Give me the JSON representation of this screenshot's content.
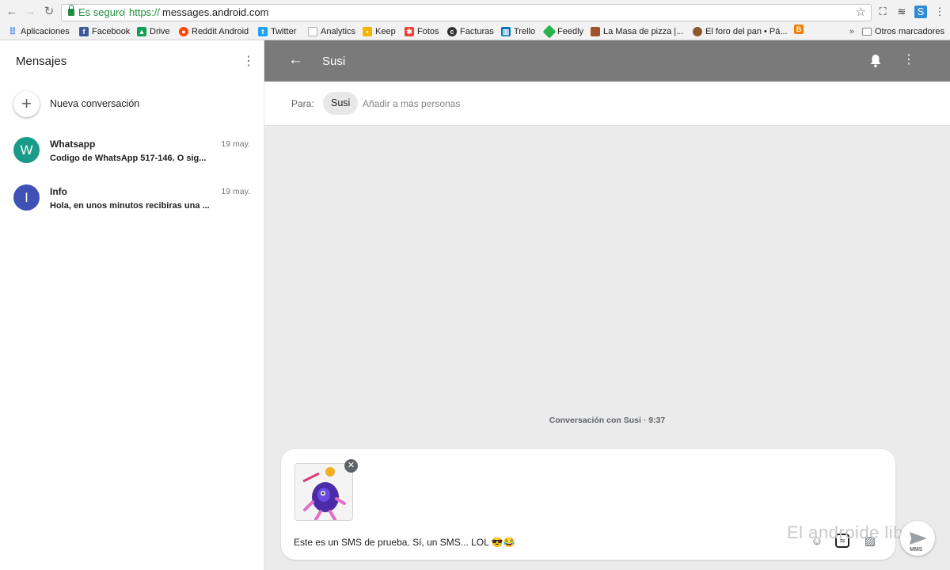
{
  "browser": {
    "secure_label": "Es seguro",
    "url_scheme": "https://",
    "url_rest": "messages.android.com",
    "bookmarks": [
      {
        "label": "Aplicaciones",
        "color": "#4285f4"
      },
      {
        "label": "Facebook",
        "color": "#3b5998"
      },
      {
        "label": "Drive",
        "color": "#0f9d58"
      },
      {
        "label": "Reddit Android",
        "color": "#ff4500"
      },
      {
        "label": "Twitter",
        "color": "#1da1f2"
      },
      {
        "label": "Analytics",
        "color": "#9e9e9e"
      },
      {
        "label": "Keep",
        "color": "#f4b400"
      },
      {
        "label": "Fotos",
        "color": "#ea4335"
      },
      {
        "label": "Facturas",
        "color": "#333333"
      },
      {
        "label": "Trello",
        "color": "#0079bf"
      },
      {
        "label": "Feedly",
        "color": "#2bb24c"
      },
      {
        "label": "La Masa de pizza |...",
        "color": "#a0522d"
      },
      {
        "label": "El foro del pan • Pá...",
        "color": "#8b5a2b"
      },
      {
        "label": "",
        "color": "#f57d00"
      }
    ],
    "more_bookmarks": "»",
    "other_bookmarks": "Otros marcadores"
  },
  "sidebar": {
    "title": "Mensajes",
    "new_conversation": "Nueva conversación",
    "conversations": [
      {
        "initial": "W",
        "name": "Whatsapp",
        "snippet": "Codigo de WhatsApp 517-146. O sig...",
        "date": "19 may.",
        "color": "#1a9b8a"
      },
      {
        "initial": "I",
        "name": "Info",
        "snippet": "Hola, en unos minutos recibiras una ...",
        "date": "19 may.",
        "color": "#3f51b5"
      }
    ]
  },
  "main": {
    "title": "Susi",
    "to_label": "Para:",
    "recipient": "Susi",
    "add_people_placeholder": "Añadir a más personas",
    "conversation_meta": "Conversación con Susi · 9:37",
    "message_text": "Este es un SMS de prueba. Sí, un SMS... LOL 😎😂",
    "send_label": "MMS",
    "watermark": "El androide libre"
  },
  "colors": {
    "appbar": "#7a7a7a",
    "background": "#ebebeb"
  }
}
